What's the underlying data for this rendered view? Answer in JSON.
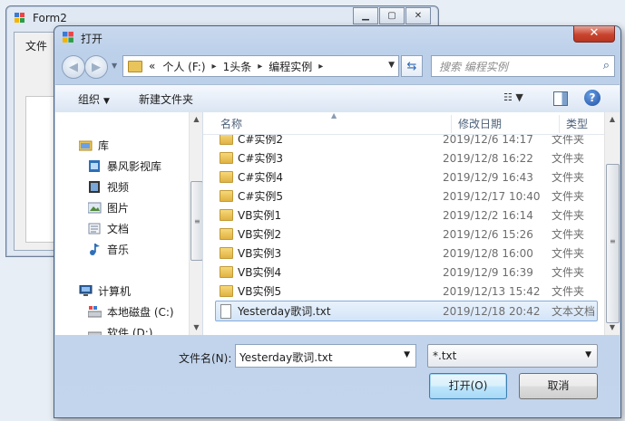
{
  "background_window": {
    "title": "Form2",
    "menu_file": "文件",
    "min_label": "▁",
    "max_label": "▢",
    "close_label": "✕"
  },
  "dialog": {
    "title": "打开",
    "close_label": "✕"
  },
  "address": {
    "prefix": "«",
    "crumbs": [
      "个人 (F:)",
      "1头条",
      "编程实例"
    ],
    "separator": "▸"
  },
  "search": {
    "placeholder": "搜索 编程实例"
  },
  "toolbar": {
    "organize": "组织",
    "new_folder": "新建文件夹",
    "help": "?"
  },
  "nav_pane": {
    "items": [
      {
        "label": "库",
        "icon": "library-icon"
      },
      {
        "label": "暴风影视库",
        "icon": "video-library-icon"
      },
      {
        "label": "视频",
        "icon": "video-icon"
      },
      {
        "label": "图片",
        "icon": "picture-icon"
      },
      {
        "label": "文档",
        "icon": "document-icon"
      },
      {
        "label": "音乐",
        "icon": "music-icon"
      },
      {
        "label": "计算机",
        "icon": "computer-icon"
      },
      {
        "label": "本地磁盘 (C:)",
        "icon": "disk-icon"
      },
      {
        "label": "软件 (D:)",
        "icon": "disk-icon"
      }
    ]
  },
  "file_list": {
    "columns": {
      "name": "名称",
      "modified": "修改日期",
      "type": "类型"
    },
    "rows": [
      {
        "name": "C#实例2",
        "modified": "2019/12/6 14:17",
        "type": "文件夹"
      },
      {
        "name": "C#实例3",
        "modified": "2019/12/8 16:22",
        "type": "文件夹"
      },
      {
        "name": "C#实例4",
        "modified": "2019/12/9 16:43",
        "type": "文件夹"
      },
      {
        "name": "C#实例5",
        "modified": "2019/12/17 10:40",
        "type": "文件夹"
      },
      {
        "name": "VB实例1",
        "modified": "2019/12/2 16:14",
        "type": "文件夹"
      },
      {
        "name": "VB实例2",
        "modified": "2019/12/6 15:26",
        "type": "文件夹"
      },
      {
        "name": "VB实例3",
        "modified": "2019/12/8 16:00",
        "type": "文件夹"
      },
      {
        "name": "VB实例4",
        "modified": "2019/12/9 16:39",
        "type": "文件夹"
      },
      {
        "name": "VB实例5",
        "modified": "2019/12/13 15:42",
        "type": "文件夹"
      },
      {
        "name": "Yesterday歌词.txt",
        "modified": "2019/12/18 20:42",
        "type": "文本文档"
      }
    ]
  },
  "bottom": {
    "filename_label": "文件名(N):",
    "filename_value": "Yesterday歌词.txt",
    "filter_value": "*.txt",
    "open_button": "打开(O)",
    "cancel_button": "取消"
  }
}
